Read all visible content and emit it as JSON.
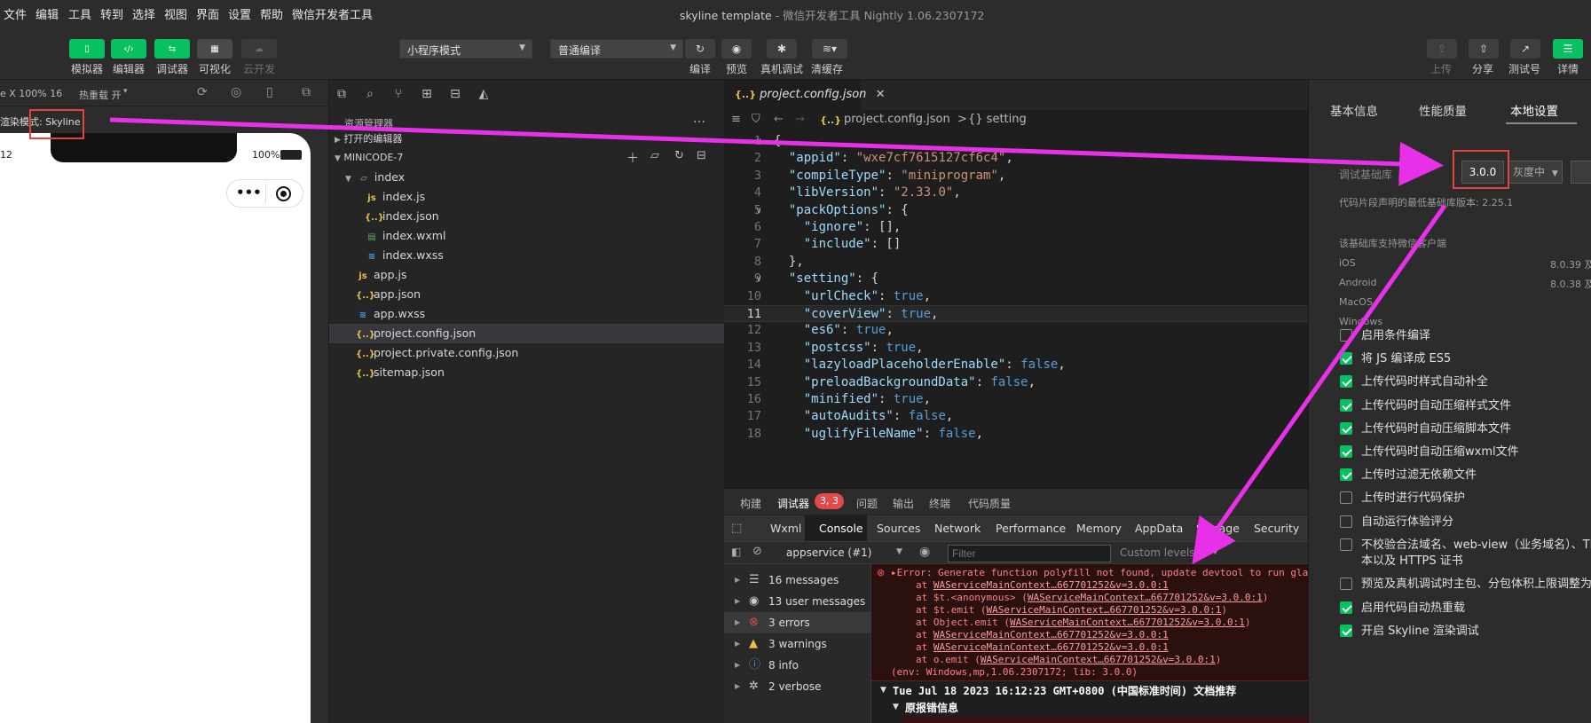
{
  "menu": [
    "文件",
    "编辑",
    "工具",
    "转到",
    "选择",
    "视图",
    "界面",
    "设置",
    "帮助",
    "微信开发者工具"
  ],
  "window_title": {
    "project": "skyline template",
    "app": "微信开发者工具 Nightly 1.06.2307172"
  },
  "toolbar": {
    "left": [
      {
        "label": "模拟器",
        "icon": "phone-icon"
      },
      {
        "label": "编辑器",
        "icon": "code-icon"
      },
      {
        "label": "调试器",
        "icon": "debug-icon"
      },
      {
        "label": "可视化",
        "icon": "layout-icon"
      },
      {
        "label": "云开发",
        "icon": "cloud-icon"
      }
    ],
    "mode_select": "小程序模式",
    "compile_select": "普通编译",
    "center": [
      {
        "label": "编译",
        "icon": "refresh-icon"
      },
      {
        "label": "预览",
        "icon": "eye-icon"
      },
      {
        "label": "真机调试",
        "icon": "bug-icon"
      },
      {
        "label": "清缓存",
        "icon": "layers-icon"
      }
    ],
    "right": [
      {
        "label": "上传",
        "icon": "upload-icon"
      },
      {
        "label": "分享",
        "icon": "share-icon"
      },
      {
        "label": "测试号",
        "icon": "external-icon"
      },
      {
        "label": "详情",
        "icon": "menu-icon"
      }
    ]
  },
  "simulator": {
    "device_info": "e X 100% 16",
    "hot_reload": "热重载 开",
    "render_mode": "渲染模式: Skyline",
    "status_time": "12",
    "battery": "100%",
    "capsule_dots": "•••"
  },
  "explorer": {
    "title": "资源管理器",
    "more": "…",
    "open_editors": "打开的编辑器",
    "project": "MINICODE-7",
    "files": [
      {
        "name": "index",
        "type": "folder",
        "depth": 1
      },
      {
        "name": "index.js",
        "type": "js",
        "depth": 2
      },
      {
        "name": "index.json",
        "type": "json",
        "depth": 2
      },
      {
        "name": "index.wxml",
        "type": "wxml",
        "depth": 2
      },
      {
        "name": "index.wxss",
        "type": "wxss",
        "depth": 2
      },
      {
        "name": "app.js",
        "type": "js",
        "depth": 1
      },
      {
        "name": "app.json",
        "type": "json",
        "depth": 1
      },
      {
        "name": "app.wxss",
        "type": "wxss",
        "depth": 1
      },
      {
        "name": "project.config.json",
        "type": "json",
        "depth": 1,
        "selected": true
      },
      {
        "name": "project.private.config.json",
        "type": "json",
        "depth": 1
      },
      {
        "name": "sitemap.json",
        "type": "json",
        "depth": 1
      }
    ]
  },
  "editor": {
    "tab": "project.config.json",
    "breadcrumb_file": "project.config.json",
    "breadcrumb_sep": ">",
    "breadcrumb_node": "{} setting",
    "lines": [
      {
        "n": "1",
        "text": "{"
      },
      {
        "n": "2",
        "text": "  \"appid\": \"wxe7cf7615127cf6c4\","
      },
      {
        "n": "3",
        "text": "  \"compileType\": \"miniprogram\","
      },
      {
        "n": "4",
        "text": "  \"libVersion\": \"2.33.0\","
      },
      {
        "n": "5",
        "text": "  \"packOptions\": {"
      },
      {
        "n": "6",
        "text": "    \"ignore\": [],"
      },
      {
        "n": "7",
        "text": "    \"include\": []"
      },
      {
        "n": "8",
        "text": "  },"
      },
      {
        "n": "9",
        "text": "  \"setting\": {"
      },
      {
        "n": "10",
        "text": "    \"urlCheck\": true,"
      },
      {
        "n": "11",
        "text": "    \"coverView\": true,"
      },
      {
        "n": "12",
        "text": "    \"es6\": true,"
      },
      {
        "n": "13",
        "text": "    \"postcss\": true,"
      },
      {
        "n": "14",
        "text": "    \"lazyloadPlaceholderEnable\": false,"
      },
      {
        "n": "15",
        "text": "    \"preloadBackgroundData\": false,"
      },
      {
        "n": "16",
        "text": "    \"minified\": true,"
      },
      {
        "n": "17",
        "text": "    \"autoAudits\": false,"
      },
      {
        "n": "18",
        "text": "    \"uglifyFileName\": false,"
      }
    ]
  },
  "devtools": {
    "tabs": [
      "构建",
      "调试器",
      "问题",
      "输出",
      "终端",
      "代码质量"
    ],
    "badge": "3, 3",
    "console_tabs": [
      "Wxml",
      "Console",
      "Sources",
      "Network",
      "Performance",
      "Memory",
      "AppData",
      "Storage",
      "Security"
    ],
    "context": "appservice (#1)",
    "filter_placeholder": "Filter",
    "levels": "Custom levels",
    "sidebar": [
      {
        "label": "16 messages",
        "icon": "list-icon"
      },
      {
        "label": "13 user messages",
        "icon": "user-icon"
      },
      {
        "label": "3 errors",
        "icon": "error-icon"
      },
      {
        "label": "3 warnings",
        "icon": "warning-icon"
      },
      {
        "label": "8 info",
        "icon": "info-icon"
      },
      {
        "label": "2 verbose",
        "icon": "gear-icon"
      }
    ],
    "error": {
      "message": "▸Error: Generate function polyfill not found, update devtool to run gla",
      "stack": [
        {
          "prefix": "at ",
          "link": "WAServiceMainContext…667701252&v=3.0.0:1",
          "suffix": ""
        },
        {
          "prefix": "at $t.<anonymous> (",
          "link": "WAServiceMainContext…667701252&v=3.0.0:1",
          "suffix": ")"
        },
        {
          "prefix": "at $t.emit (",
          "link": "WAServiceMainContext…667701252&v=3.0.0:1",
          "suffix": ")"
        },
        {
          "prefix": "at Object.emit (",
          "link": "WAServiceMainContext…667701252&v=3.0.0:1",
          "suffix": ")"
        },
        {
          "prefix": "at ",
          "link": "WAServiceMainContext…667701252&v=3.0.0:1",
          "suffix": ""
        },
        {
          "prefix": "at ",
          "link": "WAServiceMainContext…667701252&v=3.0.0:1",
          "suffix": ""
        },
        {
          "prefix": "at o.emit (",
          "link": "WAServiceMainContext…667701252&v=3.0.0:1",
          "suffix": ")"
        }
      ],
      "env": "(env: Windows,mp,1.06.2307172; lib: 3.0.0)"
    },
    "group_title": "Tue Jul 18 2023 16:12:23 GMT+0800 (中国标准时间) 文档推荐",
    "group_sub": "原报错信息"
  },
  "details": {
    "tabs": [
      "基本信息",
      "性能质量",
      "本地设置"
    ],
    "lib_label": "调试基础库",
    "lib_version": "3.0.0",
    "lib_channel": "灰度中",
    "min_lib_note": "代码片段声明的最低基础库版本: 2.25.1",
    "support_title": "该基础库支持微信客户端",
    "platforms": [
      {
        "name": "iOS",
        "ver": "8.0.39 及"
      },
      {
        "name": "Android",
        "ver": "8.0.38 及"
      },
      {
        "name": "MacOS",
        "ver": ""
      },
      {
        "name": "Windows",
        "ver": ""
      }
    ],
    "options": [
      {
        "label": "启用条件编译",
        "checked": false
      },
      {
        "label": "将 JS 编译成 ES5",
        "checked": true
      },
      {
        "label": "上传代码时样式自动补全",
        "checked": true
      },
      {
        "label": "上传代码时自动压缩样式文件",
        "checked": true
      },
      {
        "label": "上传代码时自动压缩脚本文件",
        "checked": true
      },
      {
        "label": "上传代码时自动压缩wxml文件",
        "checked": true
      },
      {
        "label": "上传时过滤无依赖文件",
        "checked": true
      },
      {
        "label": "上传时进行代码保护",
        "checked": false
      },
      {
        "label": "自动运行体验评分",
        "checked": false
      },
      {
        "label": "不校验合法域名、web-view（业务域名）、TL",
        "label2": "本以及 HTTPS 证书",
        "checked": false
      },
      {
        "label": "预览及真机调试时主包、分包体积上限调整为",
        "checked": false
      },
      {
        "label": "启用代码自动热重载",
        "checked": true
      },
      {
        "label": "开启 Skyline 渲染调试",
        "checked": true
      }
    ]
  },
  "colors": {
    "accent": "#07c160",
    "annotation": "#e830e8",
    "highlight_box": "#e8423f"
  }
}
